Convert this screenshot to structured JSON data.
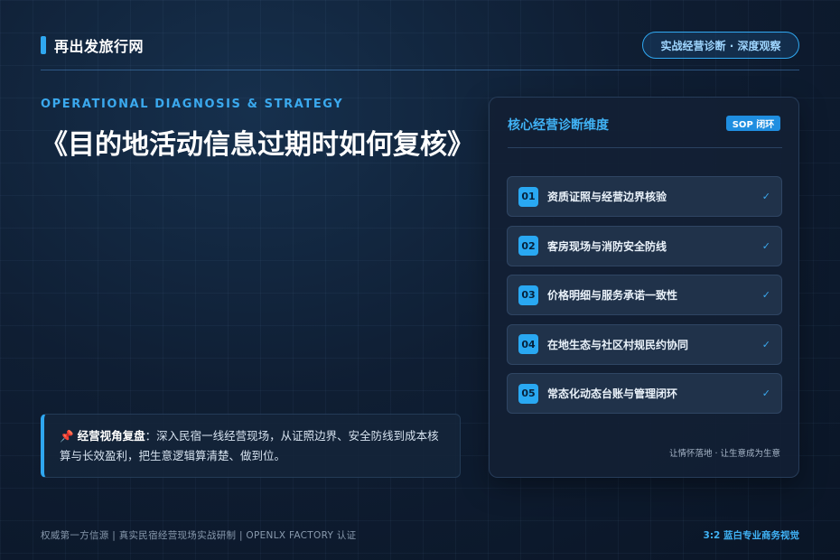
{
  "header": {
    "brand": "再出发旅行网",
    "tag": "实战经营诊断 · 深度观察"
  },
  "hero": {
    "eyebrow": "OPERATIONAL DIAGNOSIS & STRATEGY",
    "title": "《目的地活动信息过期时如何复核》"
  },
  "review": {
    "pin": "📌",
    "label": "经营视角复盘",
    "text": "：深入民宿一线经营现场，从证照边界、安全防线到成本核算与长效盈利，把生意逻辑算清楚、做到位。"
  },
  "panel": {
    "title": "核心经营诊断维度",
    "badge": "SOP 闭环",
    "items": [
      {
        "num": "01",
        "label": "资质证照与经营边界核验",
        "check": "✓"
      },
      {
        "num": "02",
        "label": "客房现场与消防安全防线",
        "check": "✓"
      },
      {
        "num": "03",
        "label": "价格明细与服务承诺一致性",
        "check": "✓"
      },
      {
        "num": "04",
        "label": "在地生态与社区村规民约协同",
        "check": "✓"
      },
      {
        "num": "05",
        "label": "常态化动态台账与管理闭环",
        "check": "✓"
      }
    ],
    "footer": "让情怀落地 · 让生意成为生意"
  },
  "footer": {
    "left": "权威第一方信源 | 真实民宿经营现场实战研制 | OPENLX FACTORY 认证",
    "right": "3:2 蓝白专业商务视觉"
  },
  "colors": {
    "accent": "#2fa7f0",
    "background": "#0f1e33"
  }
}
